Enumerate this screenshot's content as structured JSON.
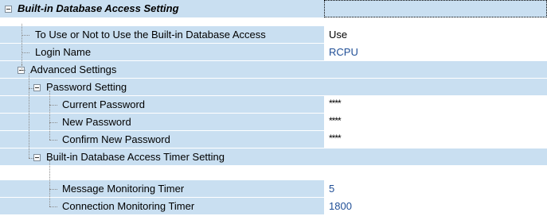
{
  "rows": {
    "title": {
      "label": "Built-in Database Access Setting",
      "value": ""
    },
    "use": {
      "label": "To Use or Not to Use the Built-in Database Access",
      "value": "Use"
    },
    "login": {
      "label": "Login Name",
      "value": "RCPU"
    },
    "advanced": {
      "label": "Advanced Settings",
      "value": ""
    },
    "password": {
      "label": "Password Setting",
      "value": ""
    },
    "current_pw": {
      "label": "Current Password",
      "value": "****"
    },
    "new_pw": {
      "label": "New Password",
      "value": "****"
    },
    "confirm_pw": {
      "label": "Confirm New Password",
      "value": "****"
    },
    "timer": {
      "label": "Built-in Database Access Timer Setting",
      "value": ""
    },
    "msg_timer": {
      "label": "Message Monitoring Timer",
      "value": "5"
    },
    "conn_timer": {
      "label": "Connection Monitoring Timer",
      "value": "1800"
    }
  },
  "colors": {
    "category_bg": "#c9dff1",
    "value_text": "#1f4e96"
  },
  "icons": [
    "collapse-minus-icon",
    "tree-line"
  ]
}
